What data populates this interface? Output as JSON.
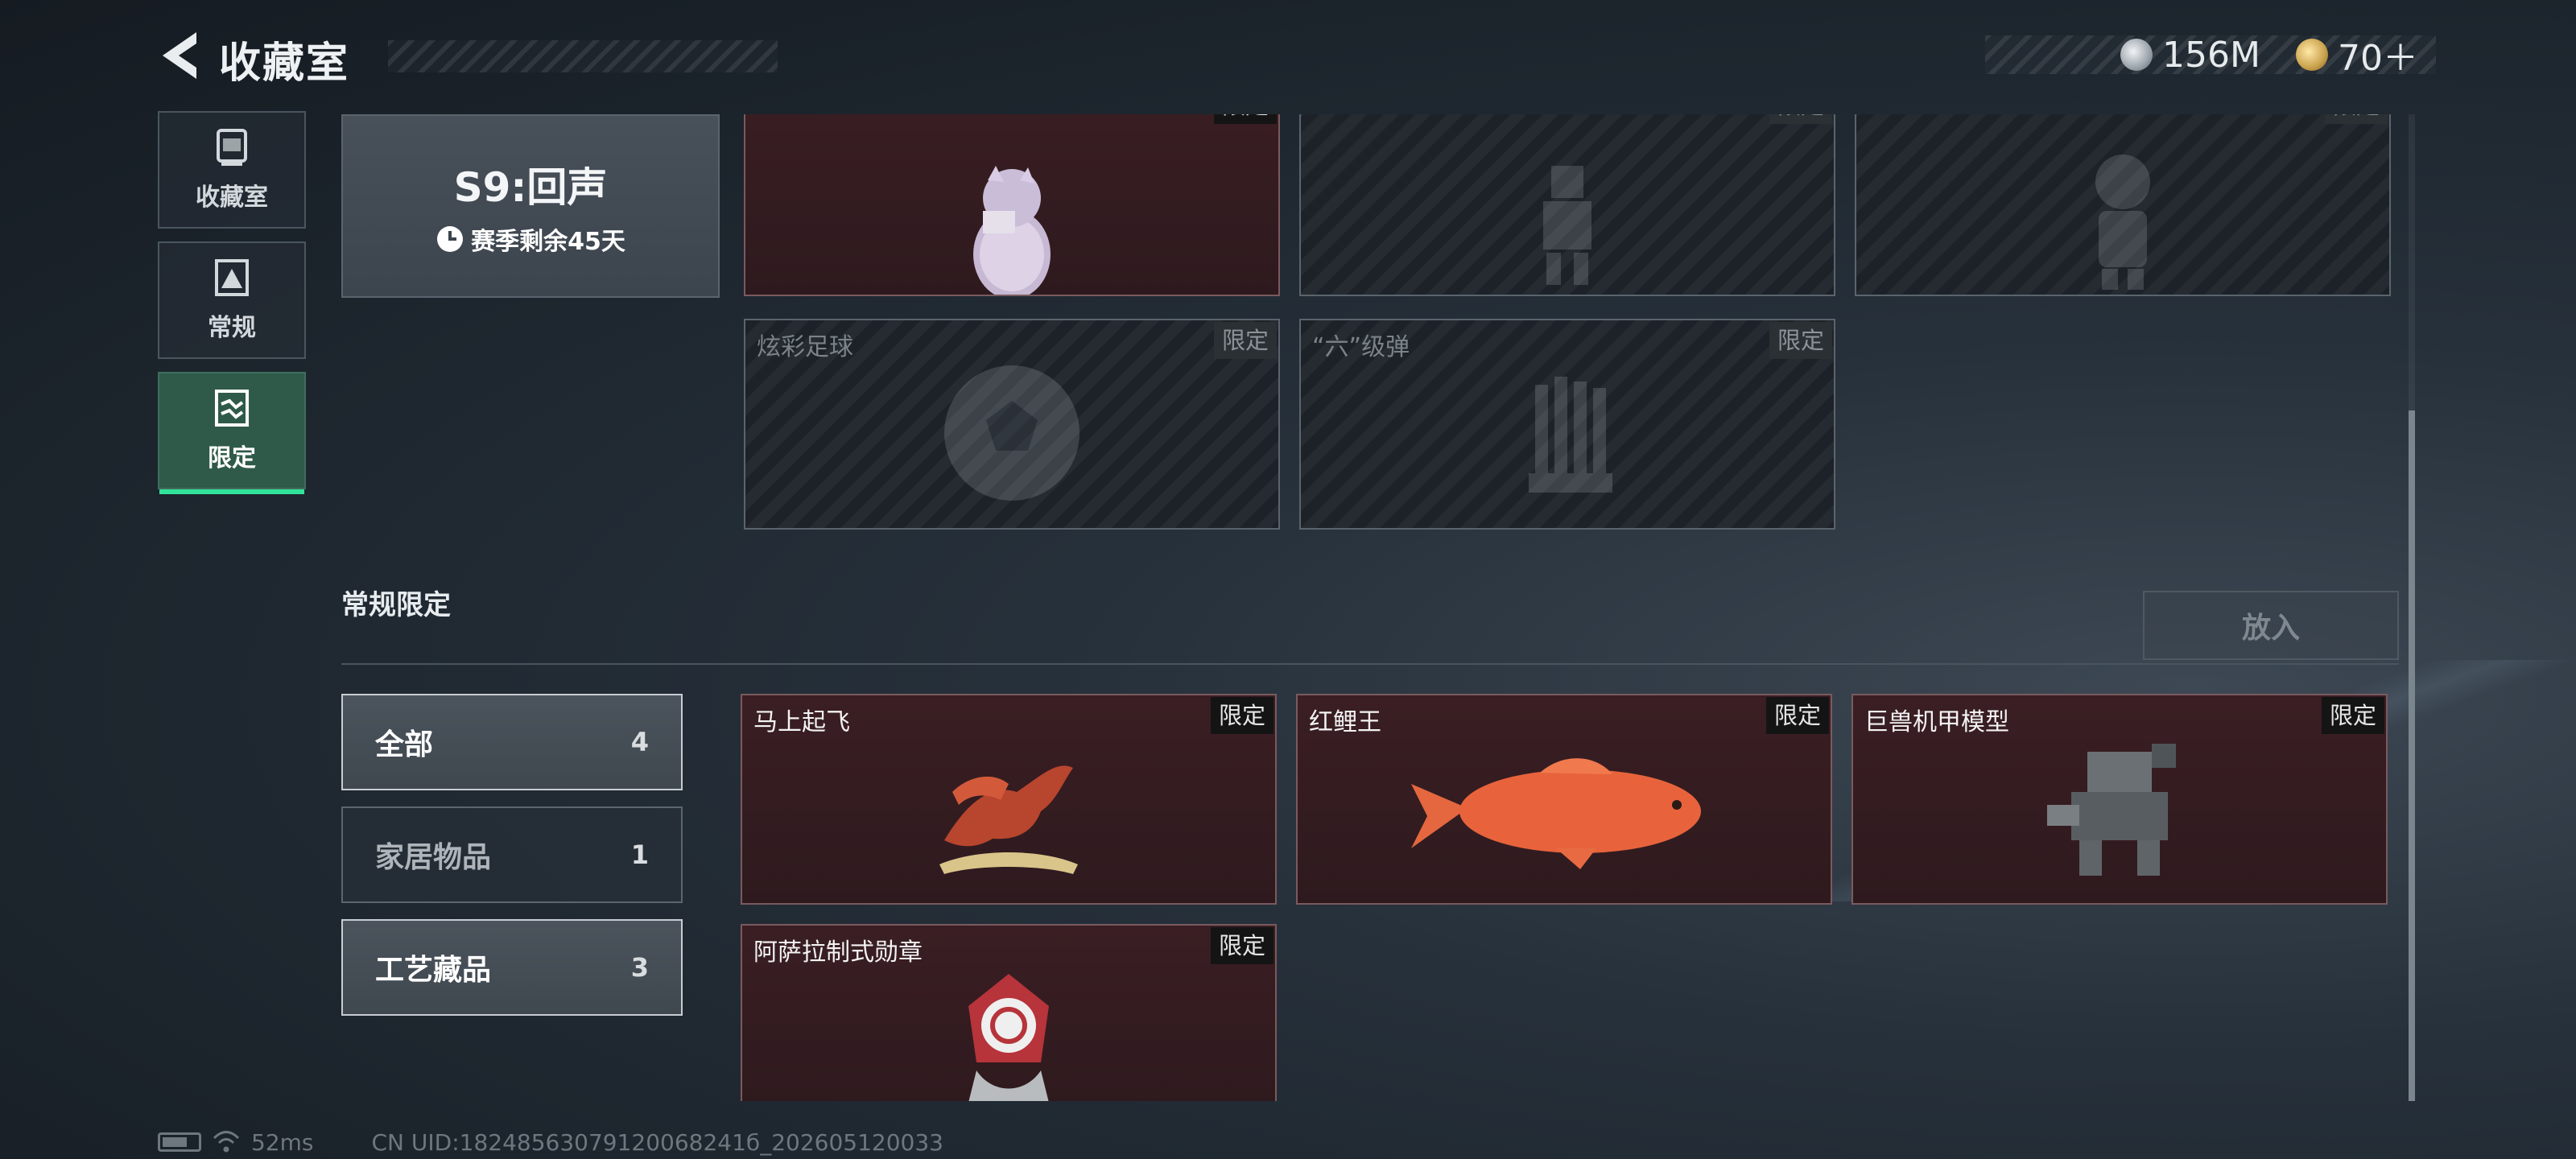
{
  "header": {
    "title": "收藏室",
    "currencies": [
      {
        "icon": "silver-coin-icon",
        "value": "156M"
      },
      {
        "icon": "gold-coin-icon",
        "value": "70＋"
      }
    ]
  },
  "side_nav": {
    "items": [
      {
        "label": "收藏室",
        "icon": "collection-room-icon",
        "active": false
      },
      {
        "label": "常规",
        "icon": "regular-icon",
        "active": false
      },
      {
        "label": "限定",
        "icon": "limited-icon",
        "active": true
      }
    ]
  },
  "season": {
    "name": "S9:回声",
    "remaining": "赛季剩余45天"
  },
  "season_items": [
    {
      "name": "",
      "badge": "限定",
      "owned": true,
      "art": "egg-creature-figurine"
    },
    {
      "name": "",
      "badge": "限定",
      "owned": false,
      "art": "robot-figurine"
    },
    {
      "name": "",
      "badge": "限定",
      "owned": false,
      "art": "doll-figurine"
    },
    {
      "name": "炫彩足球",
      "badge": "限定",
      "owned": false,
      "art": "soccer-ball"
    },
    {
      "name": "“六”级弹",
      "badge": "限定",
      "owned": false,
      "art": "shell-bundle"
    }
  ],
  "regular_limited": {
    "section_title": "常规限定",
    "put_in_label": "放入",
    "filters": [
      {
        "label": "全部",
        "count": "4",
        "selected": true
      },
      {
        "label": "家居物品",
        "count": "1",
        "selected": false
      },
      {
        "label": "工艺藏品",
        "count": "3",
        "selected": true
      }
    ],
    "items": [
      {
        "name": "马上起飞",
        "badge": "限定",
        "art": "horse-sculpture"
      },
      {
        "name": "红鲤王",
        "badge": "限定",
        "art": "red-carp"
      },
      {
        "name": "巨兽机甲模型",
        "badge": "限定",
        "art": "mech-model"
      },
      {
        "name": "阿萨拉制式勋章",
        "badge": "限定",
        "art": "asara-medal"
      }
    ]
  },
  "status_bar": {
    "ping": "52ms",
    "uid": "CN UID:18248563079120068241б_202605120033"
  }
}
